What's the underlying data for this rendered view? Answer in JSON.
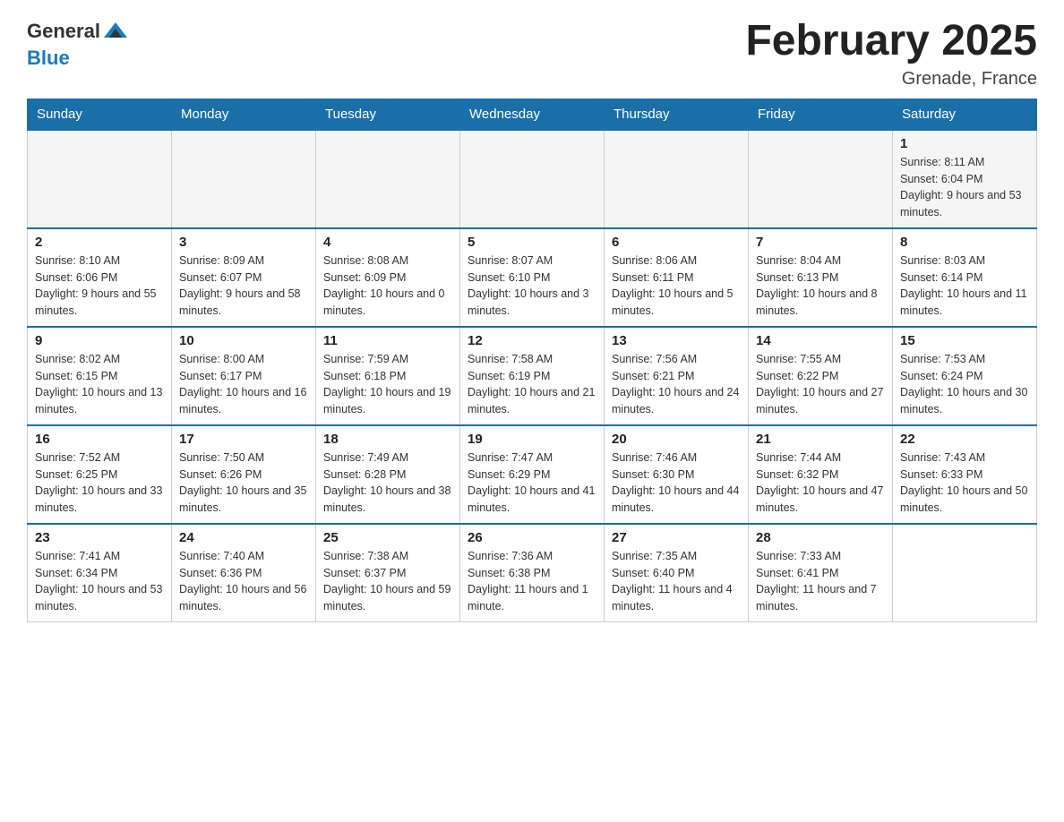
{
  "header": {
    "logo_general": "General",
    "logo_blue": "Blue",
    "month_title": "February 2025",
    "location": "Grenade, France"
  },
  "days_of_week": [
    "Sunday",
    "Monday",
    "Tuesday",
    "Wednesday",
    "Thursday",
    "Friday",
    "Saturday"
  ],
  "weeks": [
    [
      {
        "day": "",
        "info": ""
      },
      {
        "day": "",
        "info": ""
      },
      {
        "day": "",
        "info": ""
      },
      {
        "day": "",
        "info": ""
      },
      {
        "day": "",
        "info": ""
      },
      {
        "day": "",
        "info": ""
      },
      {
        "day": "1",
        "info": "Sunrise: 8:11 AM\nSunset: 6:04 PM\nDaylight: 9 hours and 53 minutes."
      }
    ],
    [
      {
        "day": "2",
        "info": "Sunrise: 8:10 AM\nSunset: 6:06 PM\nDaylight: 9 hours and 55 minutes."
      },
      {
        "day": "3",
        "info": "Sunrise: 8:09 AM\nSunset: 6:07 PM\nDaylight: 9 hours and 58 minutes."
      },
      {
        "day": "4",
        "info": "Sunrise: 8:08 AM\nSunset: 6:09 PM\nDaylight: 10 hours and 0 minutes."
      },
      {
        "day": "5",
        "info": "Sunrise: 8:07 AM\nSunset: 6:10 PM\nDaylight: 10 hours and 3 minutes."
      },
      {
        "day": "6",
        "info": "Sunrise: 8:06 AM\nSunset: 6:11 PM\nDaylight: 10 hours and 5 minutes."
      },
      {
        "day": "7",
        "info": "Sunrise: 8:04 AM\nSunset: 6:13 PM\nDaylight: 10 hours and 8 minutes."
      },
      {
        "day": "8",
        "info": "Sunrise: 8:03 AM\nSunset: 6:14 PM\nDaylight: 10 hours and 11 minutes."
      }
    ],
    [
      {
        "day": "9",
        "info": "Sunrise: 8:02 AM\nSunset: 6:15 PM\nDaylight: 10 hours and 13 minutes."
      },
      {
        "day": "10",
        "info": "Sunrise: 8:00 AM\nSunset: 6:17 PM\nDaylight: 10 hours and 16 minutes."
      },
      {
        "day": "11",
        "info": "Sunrise: 7:59 AM\nSunset: 6:18 PM\nDaylight: 10 hours and 19 minutes."
      },
      {
        "day": "12",
        "info": "Sunrise: 7:58 AM\nSunset: 6:19 PM\nDaylight: 10 hours and 21 minutes."
      },
      {
        "day": "13",
        "info": "Sunrise: 7:56 AM\nSunset: 6:21 PM\nDaylight: 10 hours and 24 minutes."
      },
      {
        "day": "14",
        "info": "Sunrise: 7:55 AM\nSunset: 6:22 PM\nDaylight: 10 hours and 27 minutes."
      },
      {
        "day": "15",
        "info": "Sunrise: 7:53 AM\nSunset: 6:24 PM\nDaylight: 10 hours and 30 minutes."
      }
    ],
    [
      {
        "day": "16",
        "info": "Sunrise: 7:52 AM\nSunset: 6:25 PM\nDaylight: 10 hours and 33 minutes."
      },
      {
        "day": "17",
        "info": "Sunrise: 7:50 AM\nSunset: 6:26 PM\nDaylight: 10 hours and 35 minutes."
      },
      {
        "day": "18",
        "info": "Sunrise: 7:49 AM\nSunset: 6:28 PM\nDaylight: 10 hours and 38 minutes."
      },
      {
        "day": "19",
        "info": "Sunrise: 7:47 AM\nSunset: 6:29 PM\nDaylight: 10 hours and 41 minutes."
      },
      {
        "day": "20",
        "info": "Sunrise: 7:46 AM\nSunset: 6:30 PM\nDaylight: 10 hours and 44 minutes."
      },
      {
        "day": "21",
        "info": "Sunrise: 7:44 AM\nSunset: 6:32 PM\nDaylight: 10 hours and 47 minutes."
      },
      {
        "day": "22",
        "info": "Sunrise: 7:43 AM\nSunset: 6:33 PM\nDaylight: 10 hours and 50 minutes."
      }
    ],
    [
      {
        "day": "23",
        "info": "Sunrise: 7:41 AM\nSunset: 6:34 PM\nDaylight: 10 hours and 53 minutes."
      },
      {
        "day": "24",
        "info": "Sunrise: 7:40 AM\nSunset: 6:36 PM\nDaylight: 10 hours and 56 minutes."
      },
      {
        "day": "25",
        "info": "Sunrise: 7:38 AM\nSunset: 6:37 PM\nDaylight: 10 hours and 59 minutes."
      },
      {
        "day": "26",
        "info": "Sunrise: 7:36 AM\nSunset: 6:38 PM\nDaylight: 11 hours and 1 minute."
      },
      {
        "day": "27",
        "info": "Sunrise: 7:35 AM\nSunset: 6:40 PM\nDaylight: 11 hours and 4 minutes."
      },
      {
        "day": "28",
        "info": "Sunrise: 7:33 AM\nSunset: 6:41 PM\nDaylight: 11 hours and 7 minutes."
      },
      {
        "day": "",
        "info": ""
      }
    ]
  ]
}
